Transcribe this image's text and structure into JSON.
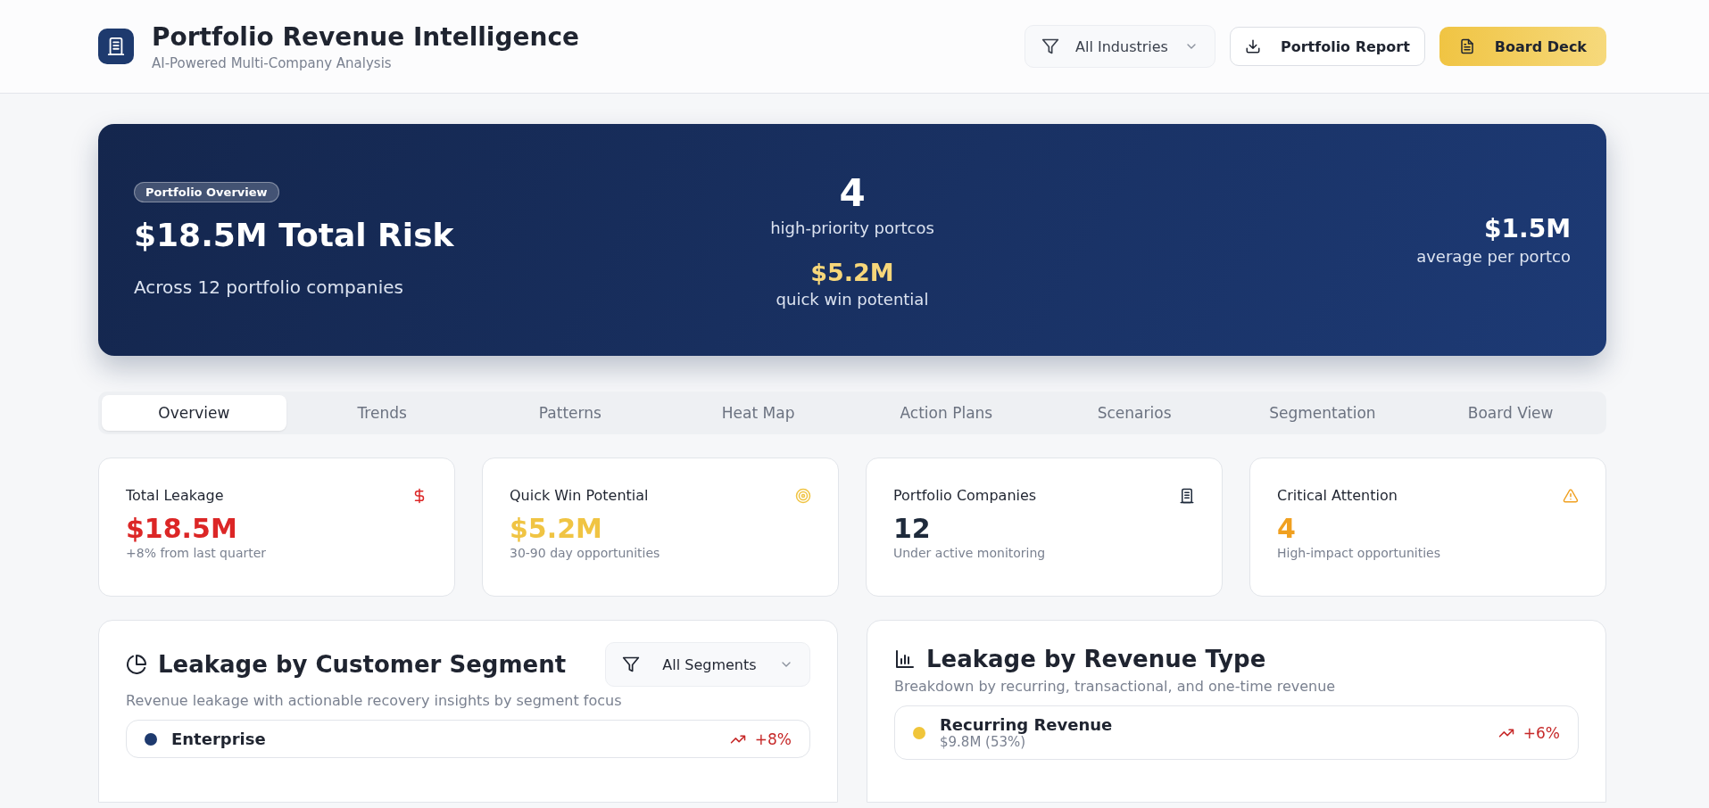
{
  "header": {
    "title": "Portfolio Revenue Intelligence",
    "subtitle": "AI-Powered Multi-Company Analysis",
    "industry_filter": {
      "value": "All Industries"
    },
    "buttons": [
      {
        "label": "Portfolio Report",
        "kind": "outline"
      },
      {
        "label": "Board Deck",
        "kind": "primary"
      }
    ]
  },
  "hero": {
    "badge": "Portfolio Overview",
    "headline": "$18.5M Total Risk",
    "caption": "Across 12 portfolio companies",
    "priority_count": "4",
    "priority_label": "high-priority portcos",
    "quick_win": "$5.2M",
    "quick_win_label": "quick win potential",
    "average": "$1.5M",
    "average_label": "average per portco"
  },
  "tabs": [
    {
      "label": "Overview",
      "selected": true
    },
    {
      "label": "Trends",
      "selected": false
    },
    {
      "label": "Patterns",
      "selected": false
    },
    {
      "label": "Heat Map",
      "selected": false
    },
    {
      "label": "Action Plans",
      "selected": false
    },
    {
      "label": "Scenarios",
      "selected": false
    },
    {
      "label": "Segmentation",
      "selected": false
    },
    {
      "label": "Board View",
      "selected": false
    }
  ],
  "metrics": [
    {
      "label": "Total Leakage",
      "value": "$18.5M",
      "note": "+8% from last quarter",
      "color": "#dc2626"
    },
    {
      "label": "Quick Win Potential",
      "value": "$5.2M",
      "note": "30-90 day opportunities",
      "color": "#f0c443"
    },
    {
      "label": "Portfolio Companies",
      "value": "12",
      "note": "Under active monitoring",
      "color": "#1e2a3b"
    },
    {
      "label": "Critical Attention",
      "value": "4",
      "note": "High-impact opportunities",
      "color": "#f0a020"
    }
  ],
  "segment_panel": {
    "title": "Leakage by Customer Segment",
    "filter": {
      "value": "All Segments"
    },
    "description": "Revenue leakage with actionable recovery insights by segment focus",
    "rows": [
      {
        "name": "Enterprise",
        "color": "#1e3a6e",
        "trend": "+8%"
      }
    ]
  },
  "revenue_panel": {
    "title": "Leakage by Revenue Type",
    "description": "Breakdown by recurring, transactional, and one-time revenue",
    "rows": [
      {
        "name": "Recurring Revenue",
        "amount": "$9.8M (53%)",
        "color": "#f0c53a",
        "trend": "+6%"
      }
    ]
  }
}
